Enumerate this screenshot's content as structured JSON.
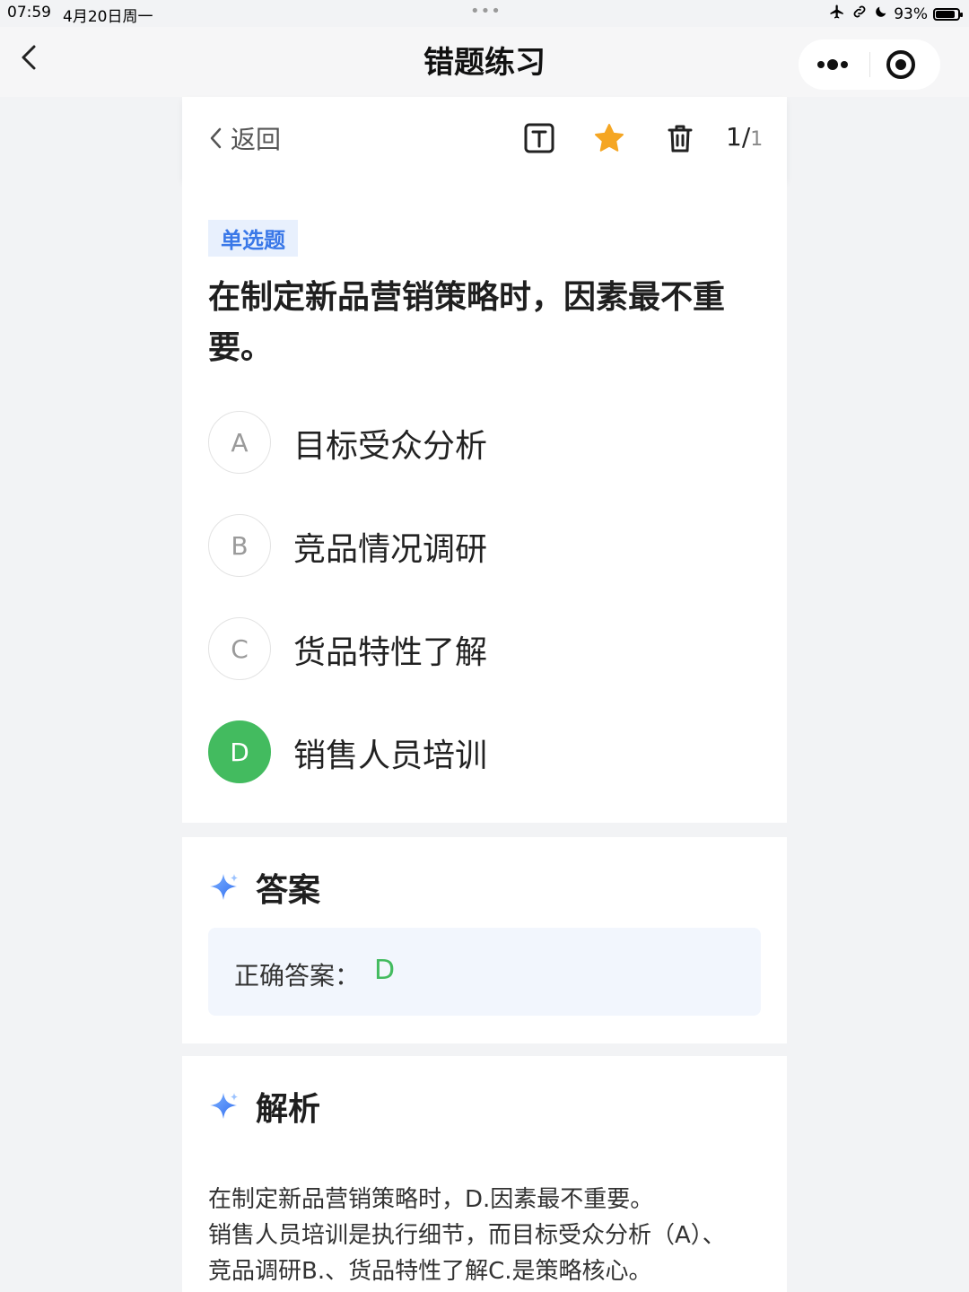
{
  "status_bar": {
    "time": "07:59",
    "date": "4月20日周一",
    "dots": "•••",
    "battery_text": "93%",
    "battery_level": 0.93
  },
  "nav": {
    "title": "错题练习"
  },
  "toolbar": {
    "back_label": "返回",
    "page_current": "1/",
    "page_total": "1"
  },
  "question": {
    "type": "单选题",
    "text": "在制定新品营销策略时，因素最不重要。",
    "options": [
      {
        "letter": "A",
        "text": "目标受众分析"
      },
      {
        "letter": "B",
        "text": "竞品情况调研"
      },
      {
        "letter": "C",
        "text": "货品特性了解"
      },
      {
        "letter": "D",
        "text": "销售人员培训"
      }
    ]
  },
  "answer": {
    "title": "答案",
    "label": "正确答案：",
    "value": "D"
  },
  "explanation": {
    "title": "解析",
    "lines": [
      "在制定新品营销策略时，D.因素最不重要。",
      "销售人员培训是执行细节，而目标受众分析（A）、",
      "竞品调研B.、货品特性了解C.是策略核心。"
    ]
  },
  "colors": {
    "correct": "#43bb5f",
    "tag": "#3a78e8",
    "star": "#f5a623"
  }
}
